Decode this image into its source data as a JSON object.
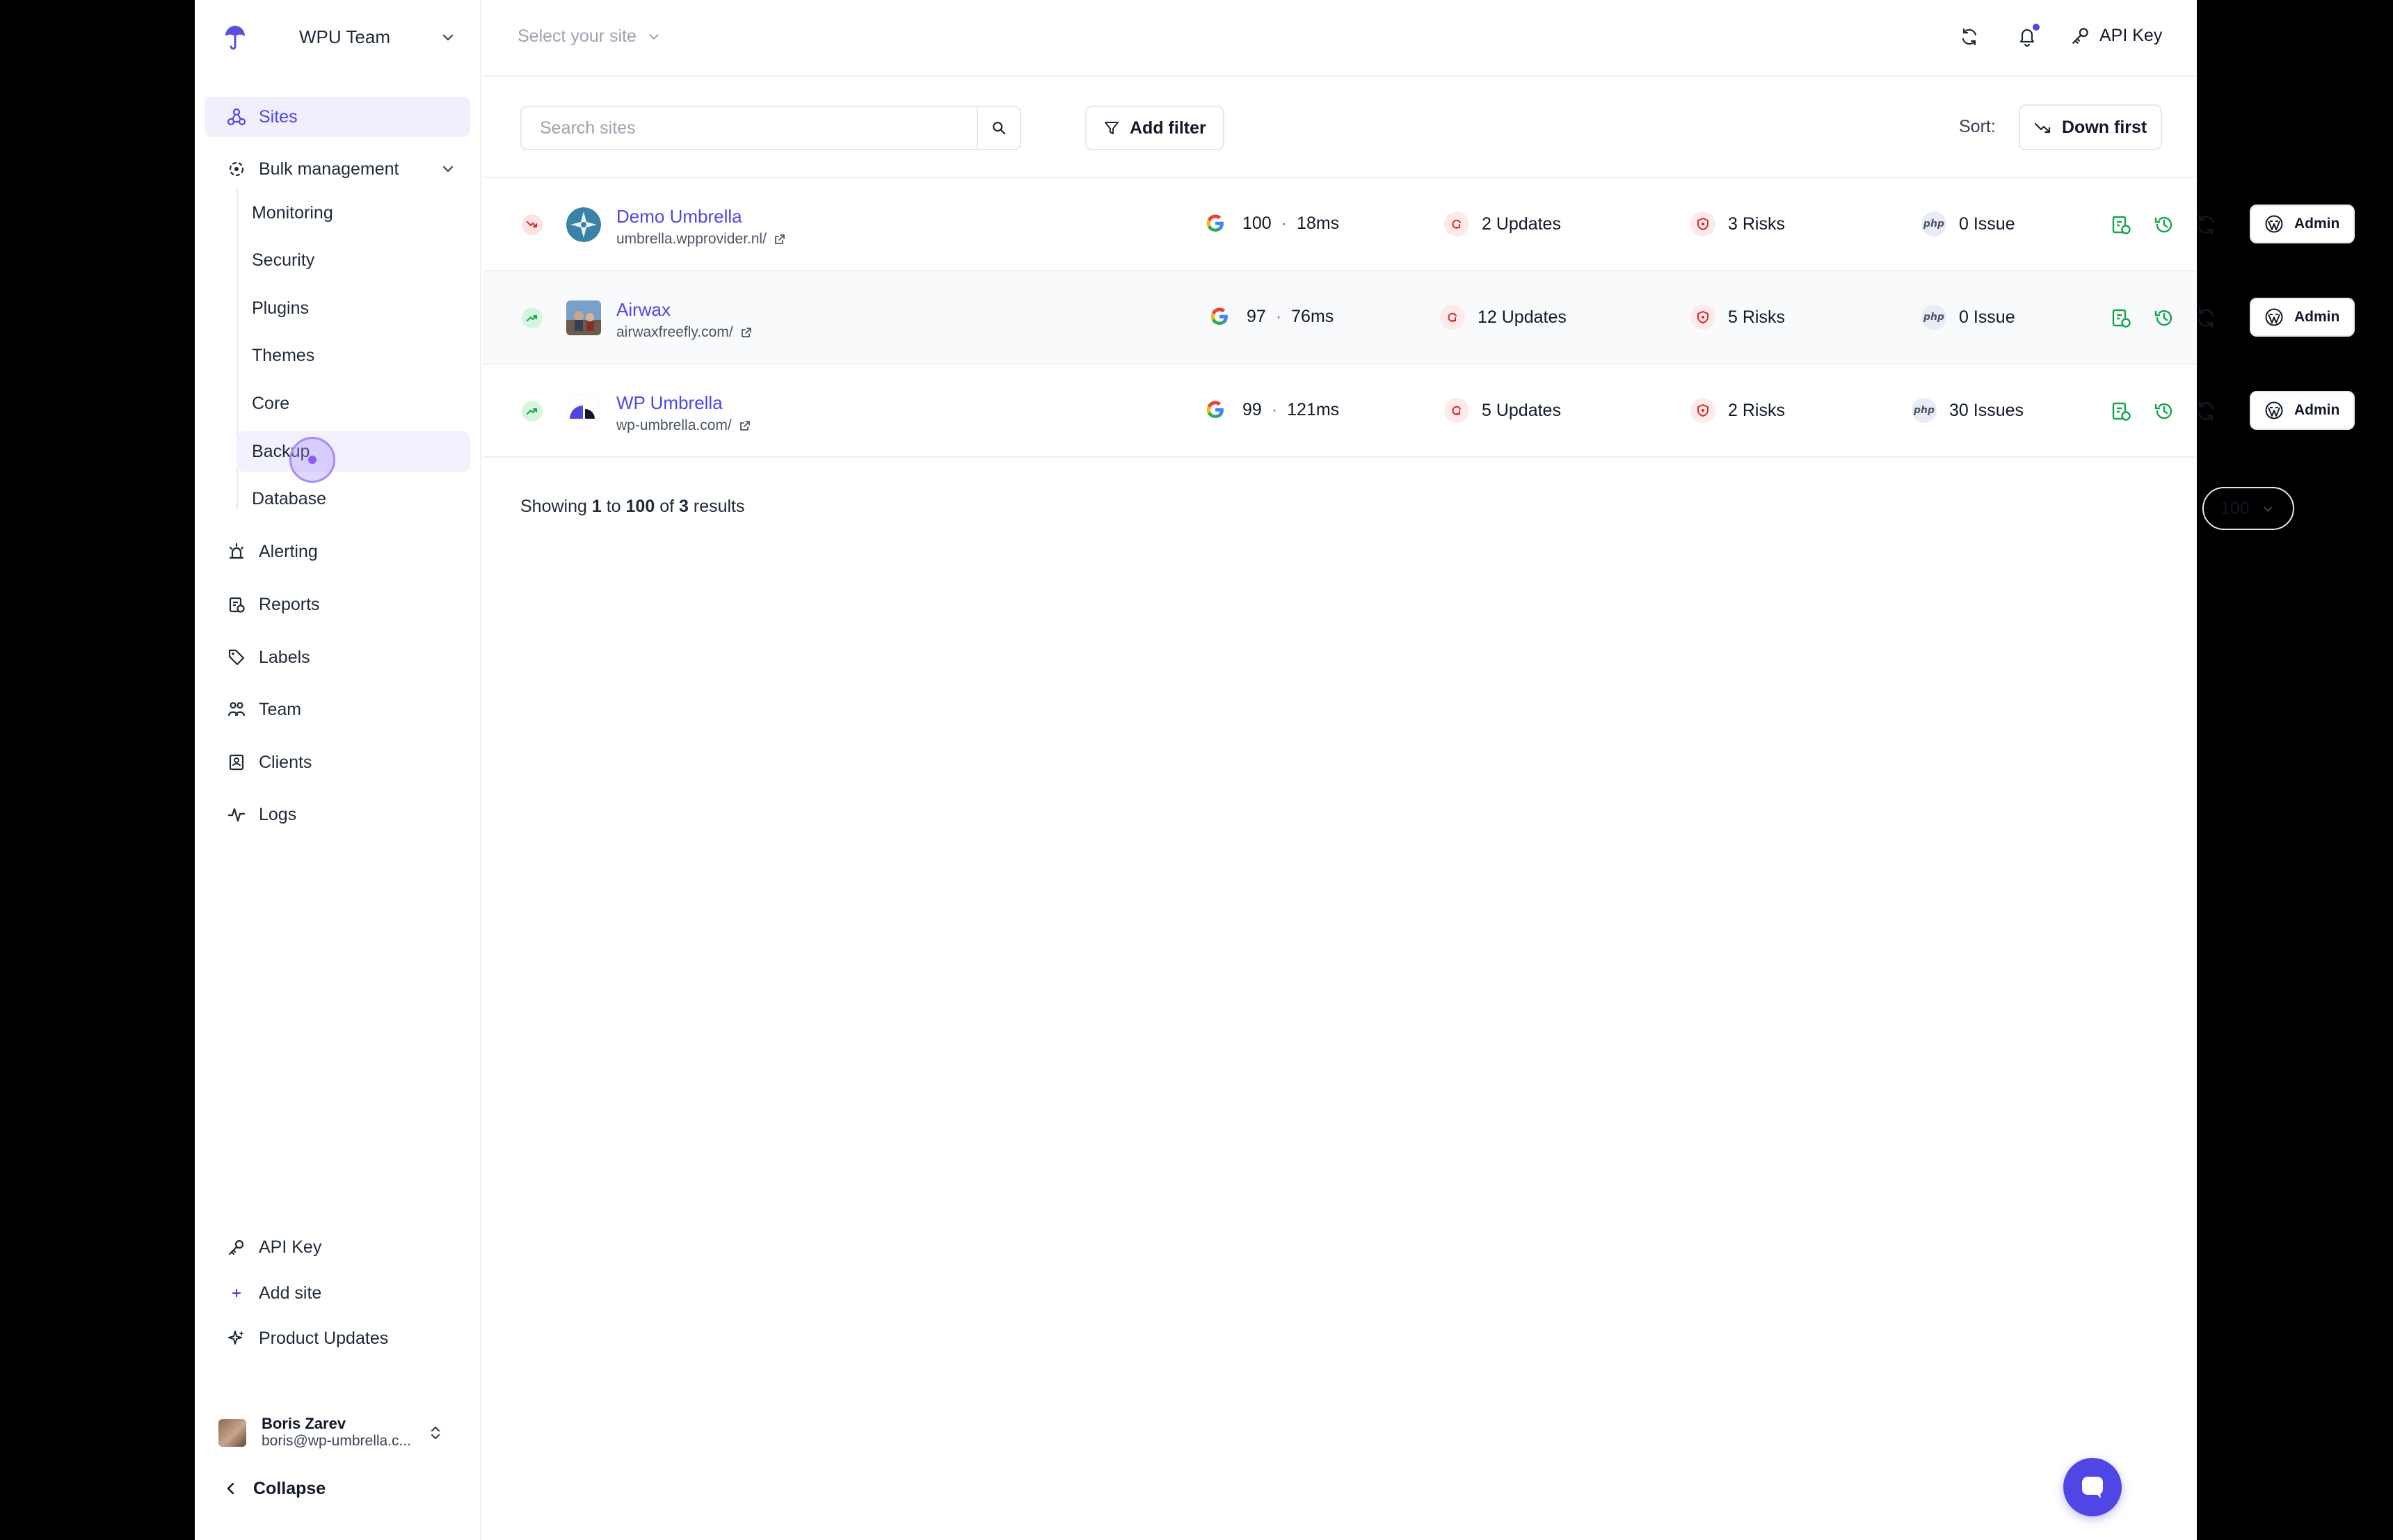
{
  "sidebar": {
    "team_name": "WPU Team",
    "nav": {
      "sites": "Sites",
      "bulk": "Bulk management",
      "alerting": "Alerting",
      "reports": "Reports",
      "labels": "Labels",
      "team": "Team",
      "clients": "Clients",
      "logs": "Logs",
      "api_key": "API Key",
      "add_site": "Add site",
      "product_updates": "Product Updates"
    },
    "bulk_items": [
      "Monitoring",
      "Security",
      "Plugins",
      "Themes",
      "Core",
      "Backup",
      "Database"
    ],
    "user": {
      "name": "Boris Zarev",
      "email": "boris@wp-umbrella.c..."
    },
    "collapse": "Collapse"
  },
  "topbar": {
    "site_select": "Select your site",
    "api_key": "API Key"
  },
  "toolbar": {
    "search_placeholder": "Search sites",
    "add_filter": "Add filter",
    "sort_label": "Sort:",
    "sort_value": "Down first"
  },
  "sites": [
    {
      "name": "Demo Umbrella",
      "url": "umbrella.wpprovider.nl/",
      "status": "down",
      "score": "100",
      "time": "18ms",
      "updates": "2 Updates",
      "risks": "3 Risks",
      "php": "0 Issue",
      "admin": "Admin"
    },
    {
      "name": "Airwax",
      "url": "airwaxfreefly.com/",
      "status": "up",
      "score": "97",
      "time": "76ms",
      "updates": "12 Updates",
      "risks": "5 Risks",
      "php": "0 Issue",
      "admin": "Admin"
    },
    {
      "name": "WP Umbrella",
      "url": "wp-umbrella.com/",
      "status": "up",
      "score": "99",
      "time": "121ms",
      "updates": "5 Updates",
      "risks": "2 Risks",
      "php": "30 Issues",
      "admin": "Admin"
    }
  ],
  "pagination": {
    "prefix": "Showing",
    "from": "1",
    "to_word": "to",
    "to": "100",
    "of_word": "of",
    "total": "3",
    "suffix": "results",
    "per_page": "100"
  },
  "php_badge": "php",
  "colors": {
    "accent": "#4f46e5",
    "active_bg": "#f2effd",
    "success": "#16a34a",
    "danger": "#dc2626"
  }
}
